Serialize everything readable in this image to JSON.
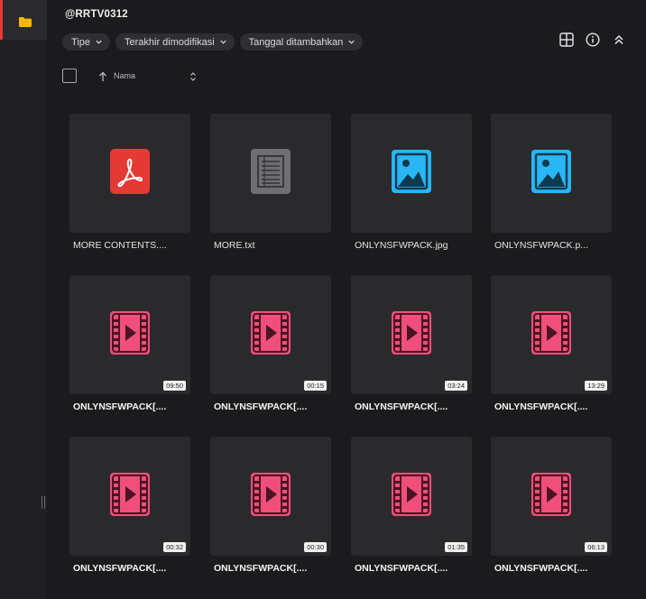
{
  "folder": {
    "title": "@RRTV0312"
  },
  "filters": [
    {
      "label": "Tipe"
    },
    {
      "label": "Terakhir dimodifikasi"
    },
    {
      "label": "Tanggal ditambahkan"
    }
  ],
  "sort": {
    "label": "Nama"
  },
  "icons": {
    "rail": "folder-icon",
    "tools": [
      "grid-view-icon",
      "info-icon",
      "collapse-icon"
    ]
  },
  "colors": {
    "accent": "#e53935",
    "pdf": "#e53935",
    "txt": "#6e6e73",
    "image": "#29b6f6",
    "video": "#ef4f7a"
  },
  "files": [
    {
      "name": "MORE CONTENTS....",
      "type": "pdf",
      "bold": false
    },
    {
      "name": "MORE.txt",
      "type": "txt",
      "bold": false
    },
    {
      "name": "ONLYNSFWPACK.jpg",
      "type": "image",
      "bold": false
    },
    {
      "name": "ONLYNSFWPACK.p...",
      "type": "image",
      "bold": false
    },
    {
      "name": "ONLYNSFWPACK[....",
      "type": "video",
      "duration": "09:50",
      "bold": true
    },
    {
      "name": "ONLYNSFWPACK[....",
      "type": "video",
      "duration": "00:15",
      "bold": true
    },
    {
      "name": "ONLYNSFWPACK[....",
      "type": "video",
      "duration": "03:24",
      "bold": true
    },
    {
      "name": "ONLYNSFWPACK[....",
      "type": "video",
      "duration": "13:29",
      "bold": true
    },
    {
      "name": "ONLYNSFWPACK[....",
      "type": "video",
      "duration": "00:32",
      "bold": true
    },
    {
      "name": "ONLYNSFWPACK[....",
      "type": "video",
      "duration": "00:30",
      "bold": true
    },
    {
      "name": "ONLYNSFWPACK[....",
      "type": "video",
      "duration": "01:35",
      "bold": true
    },
    {
      "name": "ONLYNSFWPACK[....",
      "type": "video",
      "duration": "06:13",
      "bold": true
    }
  ]
}
